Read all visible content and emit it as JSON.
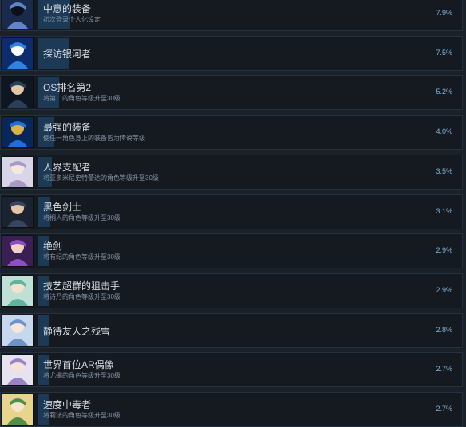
{
  "achievements": [
    {
      "title": "中意的装备",
      "desc": "初次登录个人化设定",
      "percent": "7.9%",
      "icon": "swordsman-avatar-icon",
      "colors": [
        "#1a2a4a",
        "#5f86c9",
        "#0a0f1e"
      ]
    },
    {
      "title": "探访银河者",
      "desc": "",
      "percent": "7.5%",
      "icon": "s-emblem-icon",
      "colors": [
        "#0d2c6e",
        "#2e84e0",
        "#ffffff"
      ]
    },
    {
      "title": "OS排名第2",
      "desc": "将第二的角色等级升至30级",
      "percent": "5.2%",
      "icon": "dark-swordsman-icon",
      "colors": [
        "#0e1622",
        "#2b3e5a",
        "#e0c7a8"
      ]
    },
    {
      "title": "最强的装备",
      "desc": "使任一角色身上的装备皆为传说等级",
      "percent": "4.0%",
      "icon": "legendary-sword-icon",
      "colors": [
        "#08265a",
        "#1f6fd6",
        "#d9b24a"
      ]
    },
    {
      "title": "人界支配者",
      "desc": "将亚多米尼史特蕾达的角色等级升至30级",
      "percent": "3.5%",
      "icon": "silver-hair-woman-icon",
      "colors": [
        "#d8d5e6",
        "#a79bc6",
        "#f3e8e0"
      ]
    },
    {
      "title": "黑色剑士",
      "desc": "将桐人的角色等级升至30级",
      "percent": "3.1%",
      "icon": "black-swordsman-icon",
      "colors": [
        "#1b2230",
        "#37465e",
        "#e3c6a5"
      ]
    },
    {
      "title": "绝剑",
      "desc": "将有纪的角色等级升至30级",
      "percent": "2.9%",
      "icon": "purple-hair-girl-icon",
      "colors": [
        "#3a1f55",
        "#8e4fc4",
        "#f0d2c2"
      ]
    },
    {
      "title": "技艺超群的狙击手",
      "desc": "将诗乃的角色等级升至30级",
      "percent": "2.9%",
      "icon": "green-hair-sniper-icon",
      "colors": [
        "#bfe0d4",
        "#5fb49c",
        "#f4e1d2"
      ]
    },
    {
      "title": "静待友人之残雪",
      "desc": "",
      "percent": "2.8%",
      "icon": "two-girls-icon",
      "colors": [
        "#c7d8ee",
        "#6d93c8",
        "#f6e6dc"
      ]
    },
    {
      "title": "世界首位AR偶像",
      "desc": "将尤娜的角色等级升至30级",
      "percent": "2.7%",
      "icon": "idol-girl-icon",
      "colors": [
        "#e7e2f0",
        "#9a84c6",
        "#f5e3da"
      ]
    },
    {
      "title": "速度中毒者",
      "desc": "将莉法的角色等级升至30级",
      "percent": "2.7%",
      "icon": "blonde-girl-icon",
      "colors": [
        "#e8d48a",
        "#4f8f4a",
        "#f6e4cf"
      ]
    }
  ]
}
